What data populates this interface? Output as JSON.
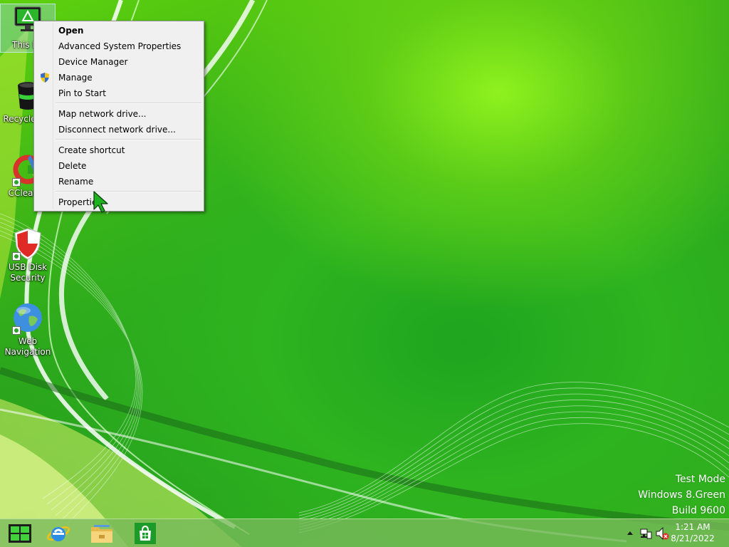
{
  "desktop": {
    "icons": [
      {
        "label": "This PC"
      },
      {
        "label": "Recycle Bin"
      },
      {
        "label": "CCleaner"
      },
      {
        "label": "USB Disk Security"
      },
      {
        "label": "Web Navigation"
      }
    ]
  },
  "context_menu": {
    "items": [
      {
        "label": "Open",
        "bold": true
      },
      {
        "label": "Advanced System Properties"
      },
      {
        "label": "Device Manager"
      },
      {
        "label": "Manage",
        "icon": "uac-shield-icon"
      },
      {
        "label": "Pin to Start"
      },
      {
        "label": "Map network drive..."
      },
      {
        "label": "Disconnect network drive..."
      },
      {
        "label": "Create shortcut"
      },
      {
        "label": "Delete"
      },
      {
        "label": "Rename"
      },
      {
        "label": "Properties"
      }
    ]
  },
  "watermark": {
    "line1": "Test Mode",
    "line2": "Windows 8.Green",
    "line3": "Build 9600"
  },
  "taskbar": {
    "pinned": [
      {
        "icon": "start-logo-icon"
      },
      {
        "icon": "internet-explorer-icon"
      },
      {
        "icon": "file-explorer-icon"
      },
      {
        "icon": "store-icon"
      }
    ],
    "tray": {
      "icons": [
        "show-hidden-icons-chevron",
        "network-icon",
        "volume-muted-icon"
      ],
      "time": "1:21 AM",
      "date": "8/21/2022"
    }
  },
  "colors": {
    "accent_green": "#2eb41f",
    "highlight_green": "#8ff21e",
    "taskbar": "#7aba5c",
    "menu_bg": "#f0f0f0"
  }
}
